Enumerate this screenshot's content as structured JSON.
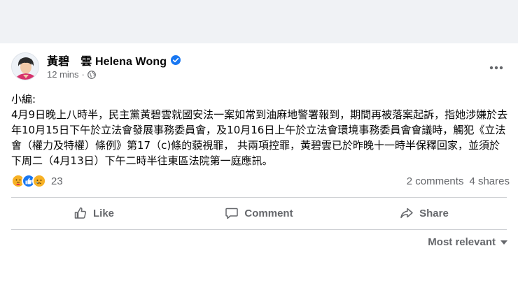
{
  "post": {
    "author": "黃碧　雲 Helena Wong",
    "time": "12 mins",
    "dot": "·",
    "body": "小編:\n4月9日晚上八時半，民主黨黃碧雲就國安法一案如常到油麻地警署報到，期間再被落案起訴，指她涉嫌於去年10月15日下午於立法會發展事務委員會，及10月16日上午於立法會環境事務委員會會議時，觸犯《立法會（權力及特權）條例》第17（c)條的藐視罪， 共兩項控罪，黃碧雲已於昨晚十一時半保釋回家，並須於下周二（4月13日）下午二時半往東區法院第一庭應訊。"
  },
  "reactions": {
    "icons": [
      "care-icon",
      "like-icon",
      "sad-icon"
    ],
    "count": "23"
  },
  "stats": {
    "comments": "2 comments",
    "shares": "4 shares"
  },
  "actions": {
    "like": "Like",
    "comment": "Comment",
    "share": "Share"
  },
  "sort": {
    "label": "Most relevant"
  },
  "colors": {
    "background": "#f0f2f5",
    "card": "#ffffff",
    "text": "#050505",
    "secondary": "#65676b",
    "accent": "#1877f2",
    "divider": "#ced0d4"
  }
}
